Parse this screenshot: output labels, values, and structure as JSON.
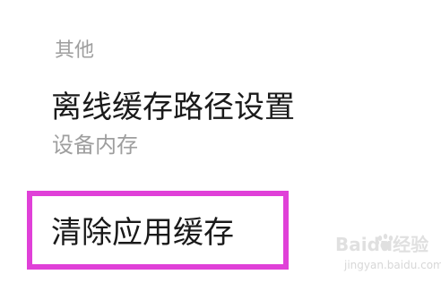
{
  "settings": {
    "section_header": "其他",
    "offline_cache": {
      "title": "离线缓存路径设置",
      "subtitle": "设备内存"
    },
    "clear_cache": {
      "label": "清除应用缓存"
    }
  },
  "annotation": {
    "highlight_color": "#e040d8"
  },
  "watermark": {
    "logo_text": "Baidu经验",
    "url": "jingyan.baidu.com"
  }
}
